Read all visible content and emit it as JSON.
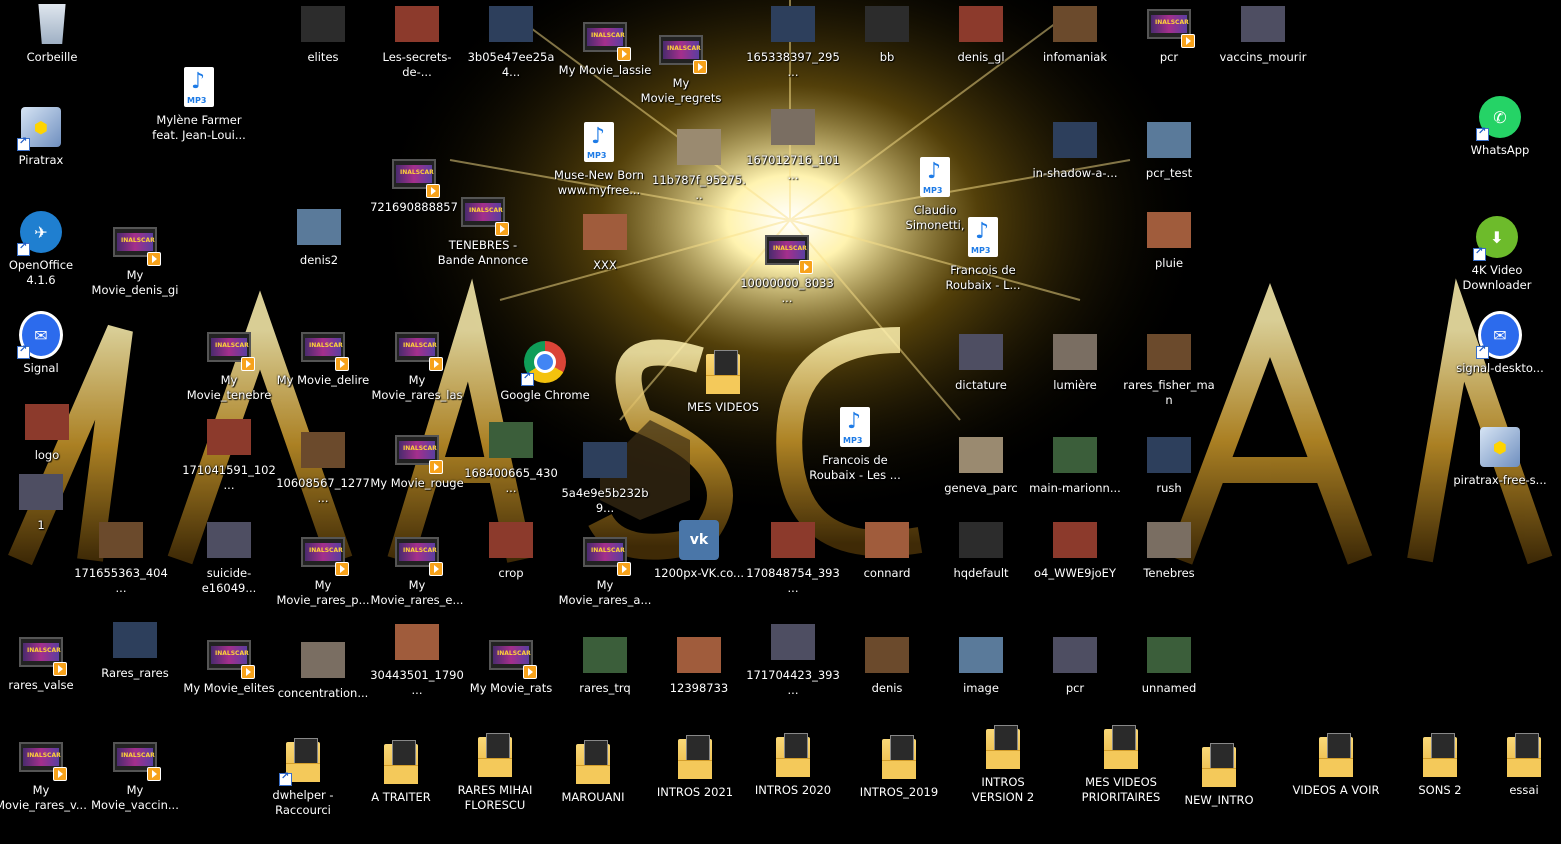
{
  "colors": {
    "background": "#000000",
    "glow": "#fff7c8",
    "banner": "#c99a2a",
    "label": "#ffffff"
  },
  "icons": [
    {
      "label": "Corbeille",
      "kind": "recycle"
    },
    {
      "label": "Piratrax",
      "kind": "setup",
      "shortcut": true
    },
    {
      "label": "OpenOffice 4.1.6",
      "kind": "openoffice",
      "shortcut": true
    },
    {
      "label": "Signal",
      "kind": "signal",
      "shortcut": true
    },
    {
      "label": "logo",
      "kind": "img"
    },
    {
      "label": "1",
      "kind": "img"
    },
    {
      "label": "rares_valse",
      "kind": "video"
    },
    {
      "label": "My Movie_rares_v...",
      "kind": "video"
    },
    {
      "label": "Mylène Farmer feat. Jean-Loui...",
      "kind": "mp3"
    },
    {
      "label": "My Movie_denis_gi",
      "kind": "video"
    },
    {
      "label": "171655363_404...",
      "kind": "img"
    },
    {
      "label": "Rares_rares",
      "kind": "img"
    },
    {
      "label": "My Movie_vaccin...",
      "kind": "video"
    },
    {
      "label": "My Movie_tenebre",
      "kind": "video"
    },
    {
      "label": "171041591_102...",
      "kind": "img"
    },
    {
      "label": "suicide-e16049...",
      "kind": "img"
    },
    {
      "label": "My Movie_elites",
      "kind": "video"
    },
    {
      "label": "elites",
      "kind": "img"
    },
    {
      "label": "denis2",
      "kind": "img"
    },
    {
      "label": "My Movie_delire",
      "kind": "video"
    },
    {
      "label": "10608567_1277...",
      "kind": "img"
    },
    {
      "label": "My Movie_rares_p...",
      "kind": "video"
    },
    {
      "label": "concentration...",
      "kind": "img"
    },
    {
      "label": "dwhelper - Raccourci",
      "kind": "folder",
      "shortcut": true
    },
    {
      "label": "Les-secrets-de-...",
      "kind": "img"
    },
    {
      "label": "721690888857",
      "kind": "video"
    },
    {
      "label": "My Movie_rares_last",
      "kind": "video"
    },
    {
      "label": "My Movie_rouge",
      "kind": "video"
    },
    {
      "label": "My Movie_rares_e...",
      "kind": "video"
    },
    {
      "label": "30443501_1790...",
      "kind": "img"
    },
    {
      "label": "A TRAITER",
      "kind": "folder"
    },
    {
      "label": "3b05e47ee25a4...",
      "kind": "img"
    },
    {
      "label": "TENEBRES - Bande Annonce",
      "kind": "video"
    },
    {
      "label": "168400665_430...",
      "kind": "img"
    },
    {
      "label": "crop",
      "kind": "img"
    },
    {
      "label": "My Movie_rats",
      "kind": "video"
    },
    {
      "label": "RARES MIHAI FLORESCU",
      "kind": "folder"
    },
    {
      "label": "My Movie_lassie",
      "kind": "video"
    },
    {
      "label": "Muse-New Born www.myfree...",
      "kind": "mp3"
    },
    {
      "label": "XXX",
      "kind": "img"
    },
    {
      "label": "Google Chrome",
      "kind": "chrome",
      "shortcut": true
    },
    {
      "label": "5a4e9e5b232b9...",
      "kind": "img"
    },
    {
      "label": "My Movie_rares_a...",
      "kind": "video"
    },
    {
      "label": "rares_trq",
      "kind": "img"
    },
    {
      "label": "MAROUANI",
      "kind": "folder"
    },
    {
      "label": "My Movie_regrets",
      "kind": "video"
    },
    {
      "label": "11b787f_95275...",
      "kind": "img"
    },
    {
      "label": "MES VIDEOS",
      "kind": "folder"
    },
    {
      "label": "1200px-VK.co...",
      "kind": "vk"
    },
    {
      "label": "12398733",
      "kind": "img"
    },
    {
      "label": "INTROS 2021",
      "kind": "folder"
    },
    {
      "label": "165338397_295...",
      "kind": "img"
    },
    {
      "label": "167012716_101...",
      "kind": "img"
    },
    {
      "label": "10000000_8033...",
      "kind": "video"
    },
    {
      "label": "170848754_393...",
      "kind": "img"
    },
    {
      "label": "171704423_393...",
      "kind": "img"
    },
    {
      "label": "INTROS 2020",
      "kind": "folder"
    },
    {
      "label": "bb",
      "kind": "img"
    },
    {
      "label": "Francois de Roubaix - Les ...",
      "kind": "mp3"
    },
    {
      "label": "connard",
      "kind": "img"
    },
    {
      "label": "denis",
      "kind": "img"
    },
    {
      "label": "INTROS_2019",
      "kind": "folder"
    },
    {
      "label": "Claudio Simonetti,",
      "kind": "mp3"
    },
    {
      "label": "Francois de Roubaix - L...",
      "kind": "mp3"
    },
    {
      "label": "denis_gl",
      "kind": "img"
    },
    {
      "label": "dictature",
      "kind": "img"
    },
    {
      "label": "geneva_parc",
      "kind": "img"
    },
    {
      "label": "hqdefault",
      "kind": "img"
    },
    {
      "label": "image",
      "kind": "img"
    },
    {
      "label": "INTROS VERSION 2",
      "kind": "folder"
    },
    {
      "label": "infomaniak",
      "kind": "img"
    },
    {
      "label": "in-shadow-a-...",
      "kind": "img"
    },
    {
      "label": "lumière",
      "kind": "img"
    },
    {
      "label": "main-marionn...",
      "kind": "img"
    },
    {
      "label": "o4_WWE9joEY",
      "kind": "img"
    },
    {
      "label": "pcr",
      "kind": "img"
    },
    {
      "label": "MES VIDEOS PRIORITAIRES",
      "kind": "folder"
    },
    {
      "label": "pcr",
      "kind": "video"
    },
    {
      "label": "pcr_test",
      "kind": "img"
    },
    {
      "label": "pluie",
      "kind": "img"
    },
    {
      "label": "rares_fisher_man",
      "kind": "img"
    },
    {
      "label": "rush",
      "kind": "img"
    },
    {
      "label": "Tenebres",
      "kind": "img"
    },
    {
      "label": "unnamed",
      "kind": "img"
    },
    {
      "label": "NEW_INTRO",
      "kind": "folder"
    },
    {
      "label": "vaccins_mourir",
      "kind": "img"
    },
    {
      "label": "VIDEOS A VOIR",
      "kind": "folder"
    },
    {
      "label": "SONS 2",
      "kind": "folder"
    },
    {
      "label": "WhatsApp",
      "kind": "whatsapp",
      "shortcut": true
    },
    {
      "label": "4K Video Downloader",
      "kind": "4k",
      "shortcut": true
    },
    {
      "label": "signal-deskto...",
      "kind": "signal",
      "shortcut": true
    },
    {
      "label": "piratrax-free-s...",
      "kind": "setup"
    },
    {
      "label": "essai",
      "kind": "folder"
    }
  ]
}
